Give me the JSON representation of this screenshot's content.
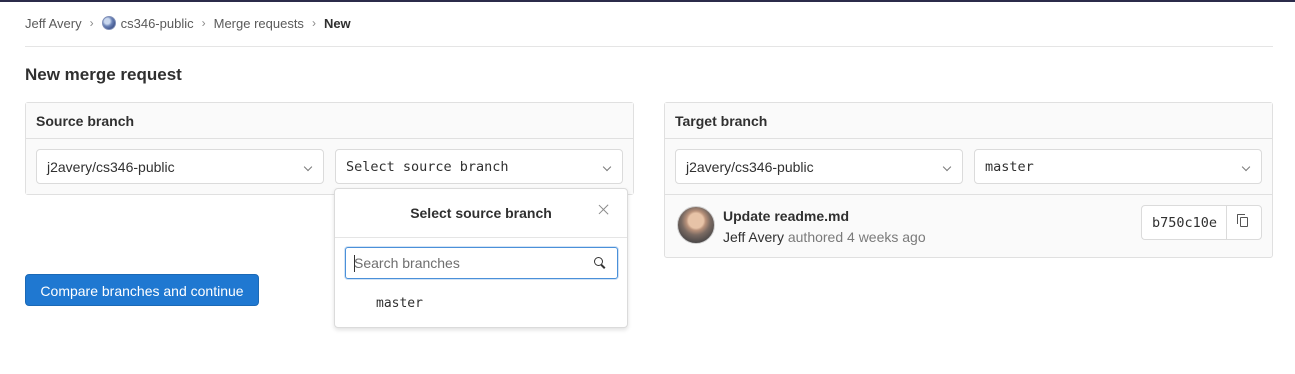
{
  "breadcrumb": {
    "items": [
      "Jeff Avery",
      "cs346-public",
      "Merge requests"
    ],
    "current": "New",
    "separator": "›"
  },
  "page": {
    "title": "New merge request"
  },
  "source": {
    "heading": "Source branch",
    "project": "j2avery/cs346-public",
    "branch_placeholder": "Select source branch"
  },
  "target": {
    "heading": "Target branch",
    "project": "j2avery/cs346-public",
    "branch": "master",
    "commit": {
      "title": "Update readme.md",
      "author": "Jeff Avery",
      "meta": "authored 4 weeks ago",
      "sha": "b750c10e"
    }
  },
  "dropdown": {
    "title": "Select source branch",
    "search_placeholder": "Search branches",
    "items": [
      "master"
    ]
  },
  "actions": {
    "compare_label": "Compare branches and continue"
  },
  "colors": {
    "primary": "#1f78d1",
    "focus": "#4a90d9"
  }
}
